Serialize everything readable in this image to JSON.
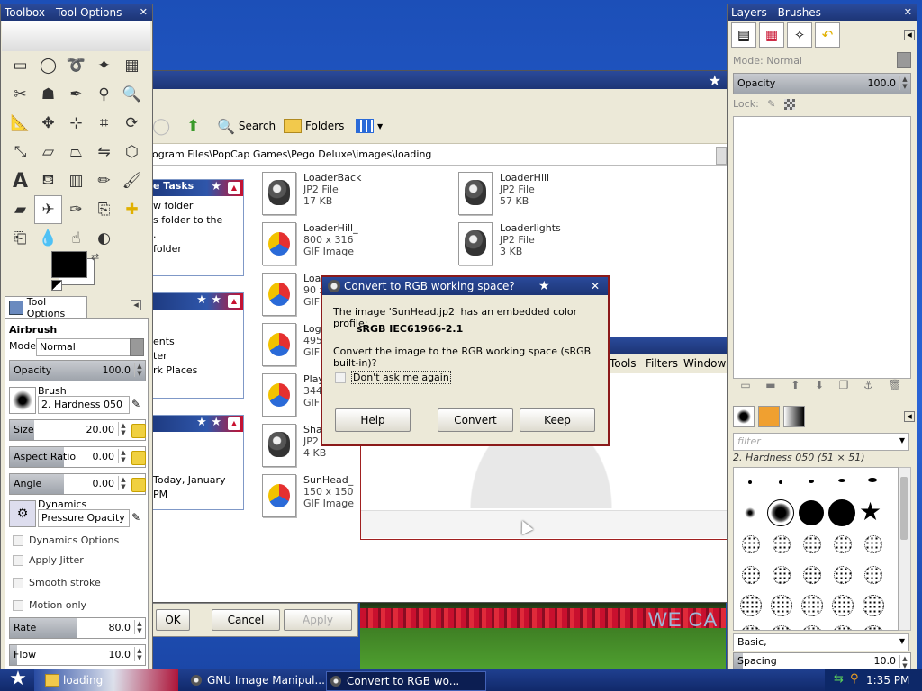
{
  "colors": {
    "accent": "#1d3576",
    "danger": "#8b1a1a",
    "flag_red": "#c8102e"
  },
  "desktop": {
    "wecan_text": "WE CA"
  },
  "explorer": {
    "toolbar": {
      "search_label": "Search",
      "folders_label": "Folders"
    },
    "address": "ogram Files\\PopCap Games\\Pego Deluxe\\images\\loading",
    "panels": [
      {
        "header": "e Tasks",
        "items": [
          "w folder",
          "s folder to the",
          ".",
          "folder"
        ]
      },
      {
        "header": "",
        "items": [
          "ents",
          "ter",
          "rk Places"
        ]
      },
      {
        "header": "",
        "items": [
          "Today, January",
          "PM"
        ]
      }
    ],
    "files": [
      {
        "name": "LoaderBack",
        "type": "JP2 File",
        "size": "17 KB",
        "icon": "gimp-icon"
      },
      {
        "name": "LoaderHill",
        "type": "JP2 File",
        "size": "57 KB",
        "icon": "gimp-icon"
      },
      {
        "name": "LoaderHill_",
        "type": "800 x 316",
        "size": "GIF Image",
        "icon": "gif-icon"
      },
      {
        "name": "Loaderlights",
        "type": "JP2 File",
        "size": "3 KB",
        "icon": "gimp-icon"
      },
      {
        "name": "Loa",
        "type": "90 x",
        "size": "GIF",
        "icon": "gif-icon"
      },
      {
        "name": "Logo",
        "type": "495",
        "size": "GIF",
        "icon": "gif-icon"
      },
      {
        "name": "Play",
        "type": "344",
        "size": "GIF",
        "icon": "gif-icon"
      },
      {
        "name": "Shac",
        "type": "JP2",
        "size": "4 KB",
        "icon": "gimp-icon"
      },
      {
        "name": "SunHead_",
        "type": "150 x 150",
        "size": "GIF Image",
        "icon": "gif-icon"
      }
    ],
    "buttons": {
      "ok": "OK",
      "cancel": "Cancel",
      "apply": "Apply"
    }
  },
  "image_window": {
    "menu": [
      "Tools",
      "Filters",
      "Windows"
    ]
  },
  "toolbox": {
    "title": "Toolbox - Tool Options",
    "tools": [
      "rect-select-icon",
      "ellipse-select-icon",
      "lasso-icon",
      "fuzzy-select-icon",
      "color-select-icon",
      "scissors-icon",
      "foreground-select-icon",
      "paths-icon",
      "color-picker-icon",
      "zoom-icon",
      "measure-icon",
      "move-icon",
      "align-icon",
      "crop-icon",
      "rotate-icon",
      "scale-icon",
      "shear-icon",
      "perspective-icon",
      "flip-icon",
      "cage-icon",
      "text-icon",
      "bucket-fill-icon",
      "blend-icon",
      "pencil-icon",
      "paintbrush-icon",
      "eraser-icon",
      "airbrush-icon",
      "ink-icon",
      "clone-icon",
      "heal-icon",
      "perspective-clone-icon",
      "blur-icon",
      "smudge-icon",
      "dodge-icon"
    ],
    "selected_tool": 26,
    "tab_label": "Tool Options",
    "tool_name": "Airbrush",
    "mode_label": "Mode:",
    "mode_value": "Normal",
    "opacity": {
      "label": "Opacity",
      "value": "100.0",
      "fraction": 1.0
    },
    "brush_label": "Brush",
    "brush_value": "2. Hardness 050",
    "size": {
      "label": "Size",
      "value": "20.00",
      "fraction": 0.18
    },
    "aspect": {
      "label": "Aspect Ratio",
      "value": "0.00",
      "fraction": 0.4
    },
    "angle": {
      "label": "Angle",
      "value": "0.00",
      "fraction": 0.4
    },
    "dynamics_label": "Dynamics",
    "dynamics_value": "Pressure Opacity",
    "checks": [
      "Dynamics Options",
      "Apply Jitter",
      "Smooth stroke",
      "Motion only"
    ],
    "rate": {
      "label": "Rate",
      "value": "80.0",
      "fraction": 0.5
    },
    "flow": {
      "label": "Flow",
      "value": "10.0",
      "fraction": 0.05
    }
  },
  "layers": {
    "title": "Layers - Brushes",
    "mode_label": "Mode:",
    "mode_value": "Normal",
    "opacity": {
      "label": "Opacity",
      "value": "100.0",
      "fraction": 1.0
    },
    "lock_label": "Lock:",
    "filter_placeholder": "filter",
    "brush_name": "2. Hardness 050 (51 × 51)",
    "preset": "Basic,",
    "spacing": {
      "label": "Spacing",
      "value": "10.0",
      "fraction": 0.05
    }
  },
  "dialog": {
    "title": "Convert to RGB working space?",
    "message": "The image 'SunHead.jp2' has an embedded color profile:",
    "profile": "sRGB IEC61966-2.1",
    "question": "Convert the image to the RGB working space (sRGB built-in)?",
    "checkbox": "Don't ask me again",
    "help": "Help",
    "convert": "Convert",
    "keep": "Keep"
  },
  "taskbar": {
    "tasks": [
      {
        "label": "loading"
      },
      {
        "label": "GNU Image Manipul..."
      },
      {
        "label": "Convert to RGB wo..."
      }
    ],
    "clock": "1:35 PM"
  }
}
